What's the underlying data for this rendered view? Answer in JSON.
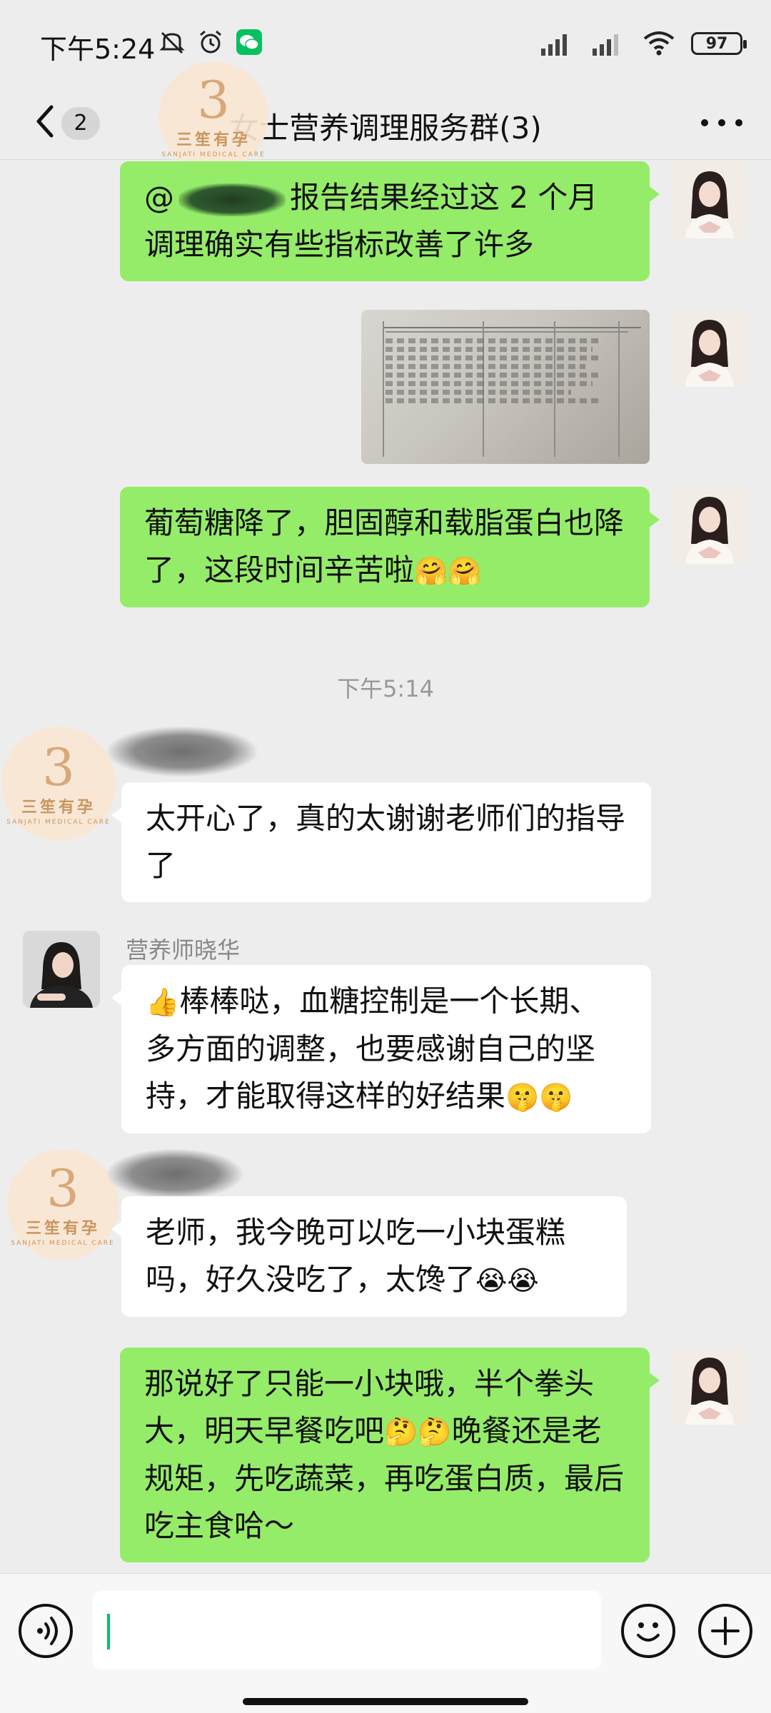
{
  "status_bar": {
    "time": "下午5:24",
    "battery": "97"
  },
  "nav": {
    "unread_count": "2",
    "title": "女士营养调理服务群(3)"
  },
  "brand": {
    "logo_cn": "三笙有孕",
    "logo_en": "SANJATI MEDICAL CARE"
  },
  "messages": {
    "m1": {
      "prefix": "@",
      "text": "报告结果经过这 2 个月调理确实有些指标改善了许多"
    },
    "m3": {
      "text": "葡萄糖降了，胆固醇和载脂蛋白也降了，这段时间辛苦啦",
      "emoji": "🤗🤗"
    },
    "time_separator": "下午5:14",
    "m4": {
      "text": "太开心了，真的太谢谢老师们的指导了"
    },
    "m5": {
      "sender": "营养师晓华",
      "emoji_lead": "👍",
      "text": "棒棒哒，血糖控制是一个长期、多方面的调整，也要感谢自己的坚持，才能取得这样的好结果",
      "emoji_tail": "🤫🤫"
    },
    "m6": {
      "text": "老师，我今晚可以吃一小块蛋糕吗，好久没吃了，太馋了",
      "emoji": "😭😭"
    },
    "m7": {
      "text_a": "那说好了只能一小块哦，半个拳头大，明天早餐吃吧",
      "emoji": "🤔🤔",
      "text_b": "晚餐还是老规矩，先吃蔬菜，再吃蛋白质，最后吃主食哈～"
    }
  },
  "colors": {
    "chat_bg": "#ededed",
    "bubble_self": "#95ec69",
    "bubble_other": "#ffffff",
    "accent": "#07c160"
  },
  "icons": [
    "back-icon",
    "more-icon",
    "voice-icon",
    "emoji-icon",
    "plus-icon",
    "wifi-icon",
    "signal-icon",
    "alarm-icon",
    "mute-icon",
    "wechat-icon"
  ]
}
